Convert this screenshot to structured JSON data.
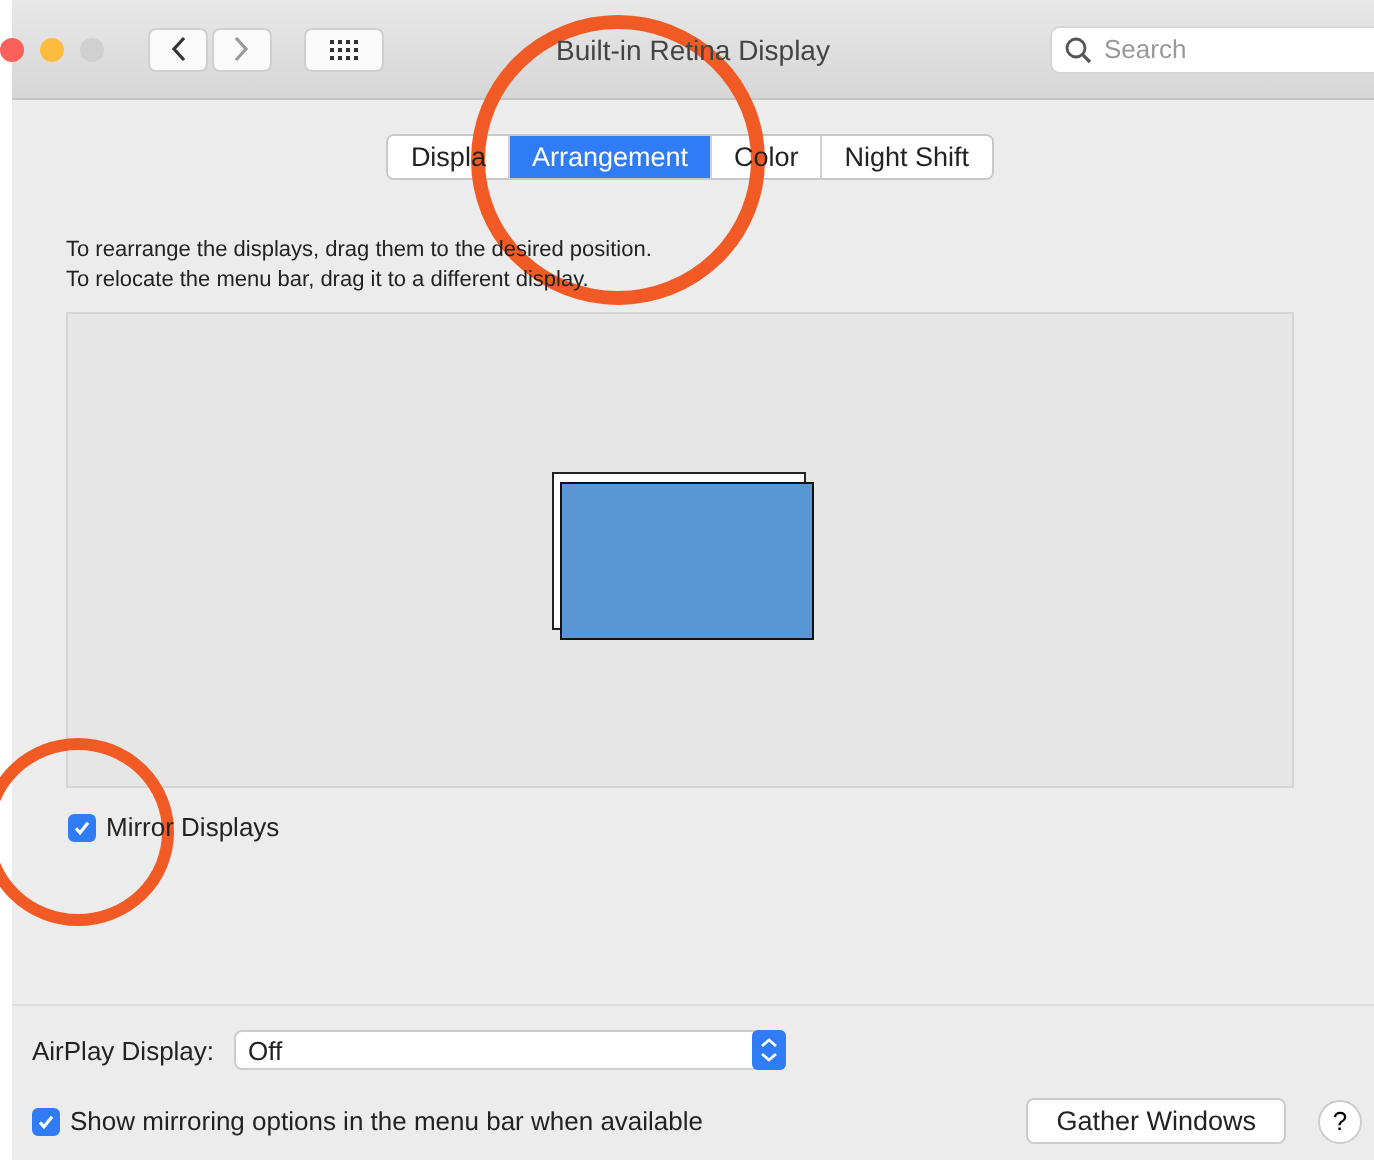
{
  "window": {
    "title": "Built-in Retina Display",
    "search": {
      "placeholder": "Search"
    }
  },
  "tabs": [
    {
      "label": "Displa",
      "selected": false
    },
    {
      "label": "Arrangement",
      "selected": true
    },
    {
      "label": "Color",
      "selected": false
    },
    {
      "label": "Night Shift",
      "selected": false
    }
  ],
  "instructions": [
    "To rearrange the displays, drag them to the desired position.",
    "To relocate the menu bar, drag it to a different display."
  ],
  "mirror_displays": {
    "label": "Mirror Displays",
    "checked": true
  },
  "airplay": {
    "label": "AirPlay Display:",
    "value": "Off"
  },
  "show_mirroring": {
    "label": "Show mirroring options in the menu bar when available",
    "checked": true
  },
  "buttons": [
    {
      "label": "Gather Windows",
      "kind": "push"
    },
    {
      "label": "?",
      "kind": "help"
    }
  ]
}
